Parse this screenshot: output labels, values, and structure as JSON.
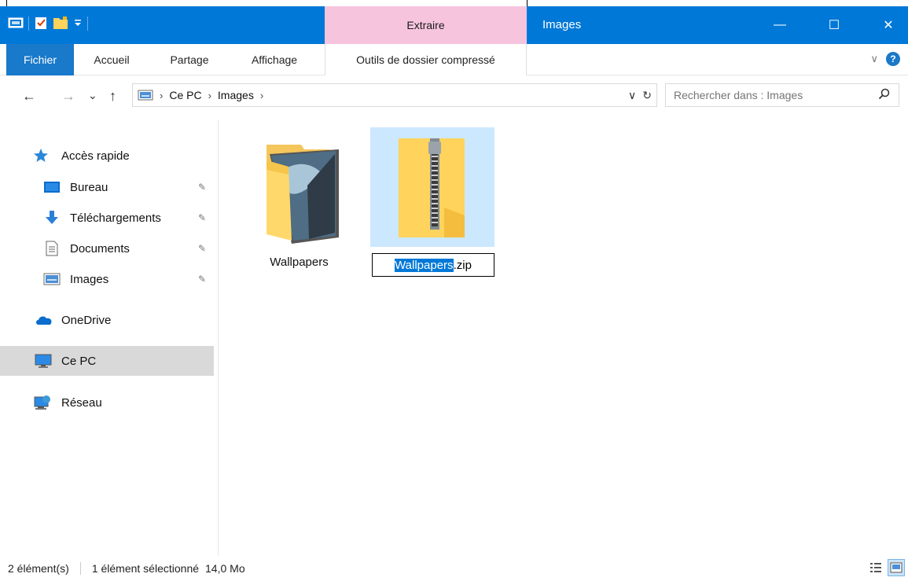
{
  "titlebar": {
    "context_tab": "Extraire",
    "title": "Images",
    "minimize": "—",
    "maximize": "☐",
    "close": "✕"
  },
  "ribbon": {
    "tabs": [
      "Fichier",
      "Accueil",
      "Partage",
      "Affichage",
      "Outils de dossier compressé"
    ],
    "collapse": "∨",
    "help": "?"
  },
  "address": {
    "back": "←",
    "forward": "→",
    "recent": "⌄",
    "up": "↑",
    "crumbs": [
      "Ce PC",
      "Images"
    ],
    "sep": "›",
    "dropdown": "∨",
    "refresh": "↻",
    "search_placeholder": "Rechercher dans : Images"
  },
  "navpane": {
    "items": [
      {
        "label": "Accès rapide",
        "icon": "star-icon"
      },
      {
        "label": "Bureau",
        "icon": "desktop-icon"
      },
      {
        "label": "Téléchargements",
        "icon": "download-icon"
      },
      {
        "label": "Documents",
        "icon": "documents-icon"
      },
      {
        "label": "Images",
        "icon": "pictures-icon"
      },
      {
        "label": "OneDrive",
        "icon": "onedrive-icon"
      },
      {
        "label": "Ce PC",
        "icon": "pc-icon"
      },
      {
        "label": "Réseau",
        "icon": "network-icon"
      }
    ]
  },
  "content": {
    "files": [
      {
        "name": "Wallpapers",
        "type": "folder"
      },
      {
        "name": "Wallpapers.zip",
        "type": "zip"
      }
    ],
    "rename_selected": "Wallpapers",
    "rename_rest": ".zip"
  },
  "status": {
    "count": "2 élément(s)",
    "selected": "1 élément sélectionné",
    "size": "14,0 Mo"
  },
  "colors": {
    "titlebar": "#0078d7",
    "context_tab": "#f7c4de",
    "selection": "#cce8ff",
    "nav_selected": "#d9d9d9"
  }
}
